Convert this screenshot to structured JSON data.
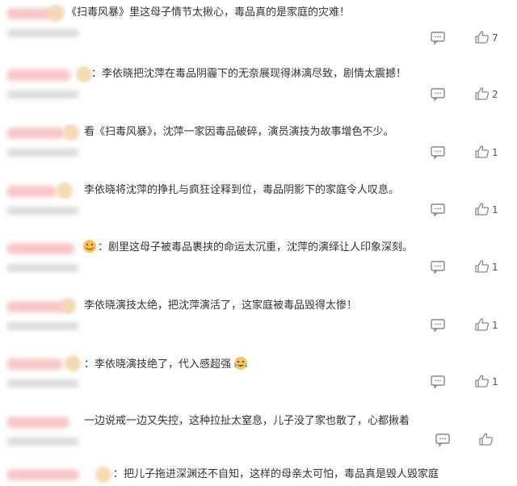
{
  "comments": [
    {
      "text": "《扫毒风暴》里这母子情节太揪心，毒品真的是家庭的灾难！",
      "likes": "7"
    },
    {
      "text": "：李依晓把沈萍在毒品阴霾下的无奈展现得淋漓尽致，剧情太震撼！",
      "likes": "2"
    },
    {
      "text": "看《扫毒风暴》，沈萍一家因毒品破碎，演员演技为故事增色不少。",
      "likes": "1"
    },
    {
      "text": "李依晓将沈萍的挣扎与疯狂诠释到位，毒品阴影下的家庭令人叹息。",
      "likes": "1"
    },
    {
      "text": "：剧里这母子被毒品裹挟的命运太沉重，沈萍的演绎让人印象深刻。",
      "likes": "1"
    },
    {
      "text": "李依晓演技太绝，把沈萍演活了，这家庭被毒品毁得太惨！",
      "likes": "1"
    },
    {
      "text": "：李依晓演技绝了，代入感超强",
      "likes": "1"
    },
    {
      "text": "一边说戒一边又失控，这种拉扯太窒息，儿子没了家也散了，心都揪着",
      "likes": ""
    },
    {
      "text": "：把儿子拖进深渊还不自知，这样的母亲太可怕，毒品真是毁人毁家庭",
      "likes": ""
    }
  ],
  "icons": {
    "reply": "comment-bubble-icon",
    "like": "thumbs-up-icon",
    "emoji": "smiley-emoji-icon",
    "badge": "user-badge-icon"
  },
  "colors": {
    "blur_name": "#f6b8b8",
    "icon_gray": "#888888"
  }
}
